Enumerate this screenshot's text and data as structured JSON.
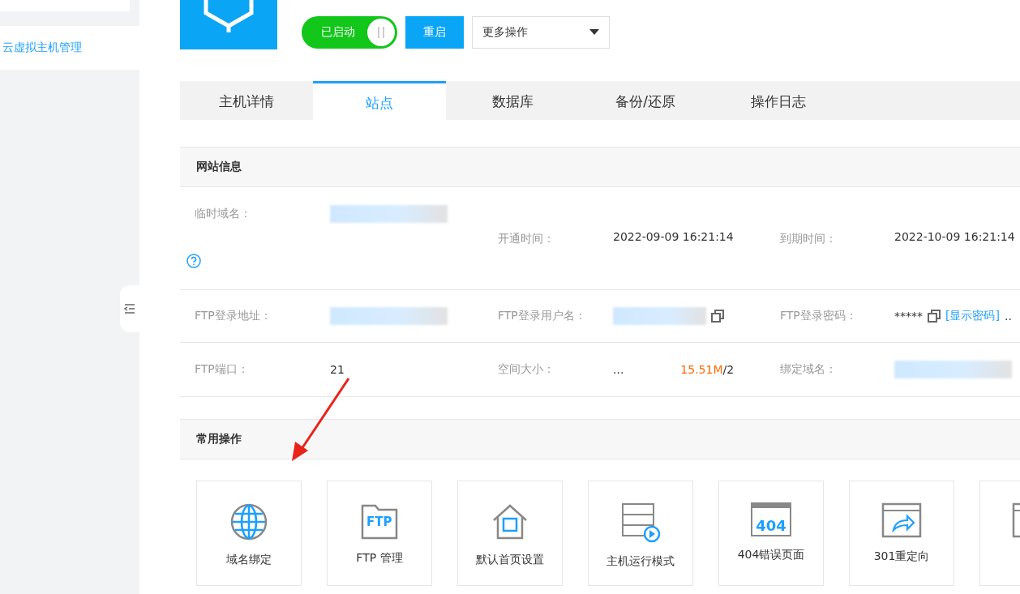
{
  "sidebar": {
    "items": [
      {
        "label": "云虚拟主机管理",
        "selected": true
      }
    ]
  },
  "header": {
    "status_toggle": {
      "label": "已启动",
      "on": true
    },
    "restart_button": "重启",
    "more_select": "更多操作"
  },
  "tabs": [
    {
      "label": "主机详情",
      "selected": false
    },
    {
      "label": "站点",
      "selected": true
    },
    {
      "label": "数据库",
      "selected": false
    },
    {
      "label": "备份/还原",
      "selected": false
    },
    {
      "label": "操作日志",
      "selected": false
    }
  ],
  "site_info": {
    "title": "网站信息",
    "rows": [
      [
        {
          "label": "临时域名：",
          "kind": "redacted"
        },
        {
          "label": "开通时间：",
          "kind": "text",
          "value": "2022-09-09 16:21:14"
        },
        {
          "label": "到期时间：",
          "kind": "text",
          "value": "2022-10-09 16:21:14"
        }
      ],
      [
        {
          "label": "FTP登录地址：",
          "kind": "redacted"
        },
        {
          "label": "FTP登录用户名：",
          "kind": "redacted",
          "copy": true
        },
        {
          "label": "FTP登录密码：",
          "kind": "text",
          "value": "*****",
          "copy": true,
          "link": "[显示密码]",
          "extra": ".."
        }
      ],
      [
        {
          "label": "FTP端口：",
          "kind": "text",
          "value": "21"
        },
        {
          "label": "空间大小：",
          "kind": "usage",
          "value": "...",
          "used": "15.51M",
          "rest": "/2"
        },
        {
          "label": "绑定域名：",
          "kind": "redacted"
        }
      ]
    ]
  },
  "common_ops": {
    "title": "常用操作",
    "items": [
      {
        "label": "域名绑定",
        "kind": "globe"
      },
      {
        "label": "FTP 管理",
        "kind": "ftp",
        "icon_text": "FTP"
      },
      {
        "label": "默认首页设置",
        "kind": "home"
      },
      {
        "label": "主机运行模式",
        "kind": "server"
      },
      {
        "label": "404错误页面",
        "kind": "page",
        "icon_text": "404"
      },
      {
        "label": "301重定向",
        "kind": "redirect"
      },
      {
        "kind": "window"
      }
    ]
  }
}
